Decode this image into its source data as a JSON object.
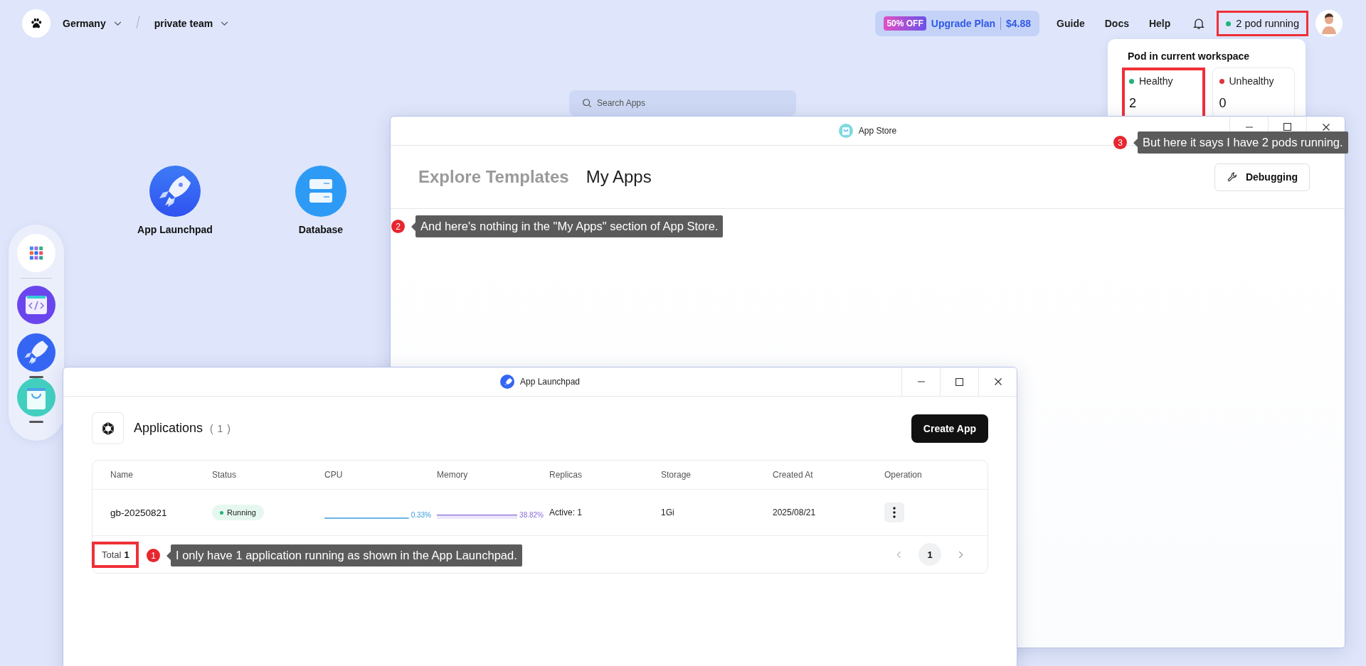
{
  "top_bar": {
    "workspace": "Germany",
    "team": "private team",
    "promo": {
      "badge": "50% OFF",
      "label": "Upgrade Plan",
      "price": "$4.88"
    },
    "links": [
      "Guide",
      "Docs",
      "Help"
    ],
    "pods": {
      "label": "2 pod running",
      "color": "#1fb37a",
      "highlighted": true
    }
  },
  "pod_popover": {
    "title": "Pod in current workspace",
    "cards": [
      {
        "label": "Healthy",
        "count": "2",
        "color": "#1fb37a",
        "highlighted": true
      },
      {
        "label": "Unhealthy",
        "count": "0",
        "color": "#d9363e",
        "highlighted": false
      }
    ]
  },
  "search": {
    "placeholder": "Search Apps"
  },
  "desktop_icons": [
    {
      "label": "App Launchpad",
      "kind": "rocket"
    },
    {
      "label": "Database",
      "kind": "database"
    }
  ],
  "dock": [
    {
      "kind": "grid",
      "running": false
    },
    {
      "kind": "code",
      "running": false
    },
    {
      "kind": "rocket",
      "running": true
    },
    {
      "kind": "store",
      "running": true
    }
  ],
  "app_store": {
    "title": "App Store",
    "tabs": [
      {
        "label": "Explore Templates",
        "selected": false
      },
      {
        "label": "My Apps",
        "selected": true
      }
    ],
    "button": "Debugging"
  },
  "launchpad": {
    "title": "App Launchpad",
    "heading": "Applications",
    "count": "( 1 )",
    "create_button": "Create App",
    "columns": [
      "Name",
      "Status",
      "CPU",
      "Memory",
      "Replicas",
      "Storage",
      "Created At",
      "Operation"
    ],
    "rows": [
      {
        "name": "gb-20250821",
        "status": "Running",
        "cpu": "0.33%",
        "memory": "38.82%",
        "replicas": "Active: 1",
        "storage": "1Gi",
        "created_at": "2025/08/21"
      }
    ],
    "total": {
      "label": "Total",
      "value": "1",
      "highlighted": true
    },
    "pages": [
      {
        "label": "1",
        "selected": true
      }
    ]
  },
  "annotations": [
    {
      "number": "3",
      "text": "But here it says I have 2 pods running."
    },
    {
      "number": "2",
      "text": "And here's nothing in the \"My Apps\" section of App Store."
    },
    {
      "number": "1",
      "text": "I only have 1 application running as shown in the App Launchpad."
    }
  ]
}
